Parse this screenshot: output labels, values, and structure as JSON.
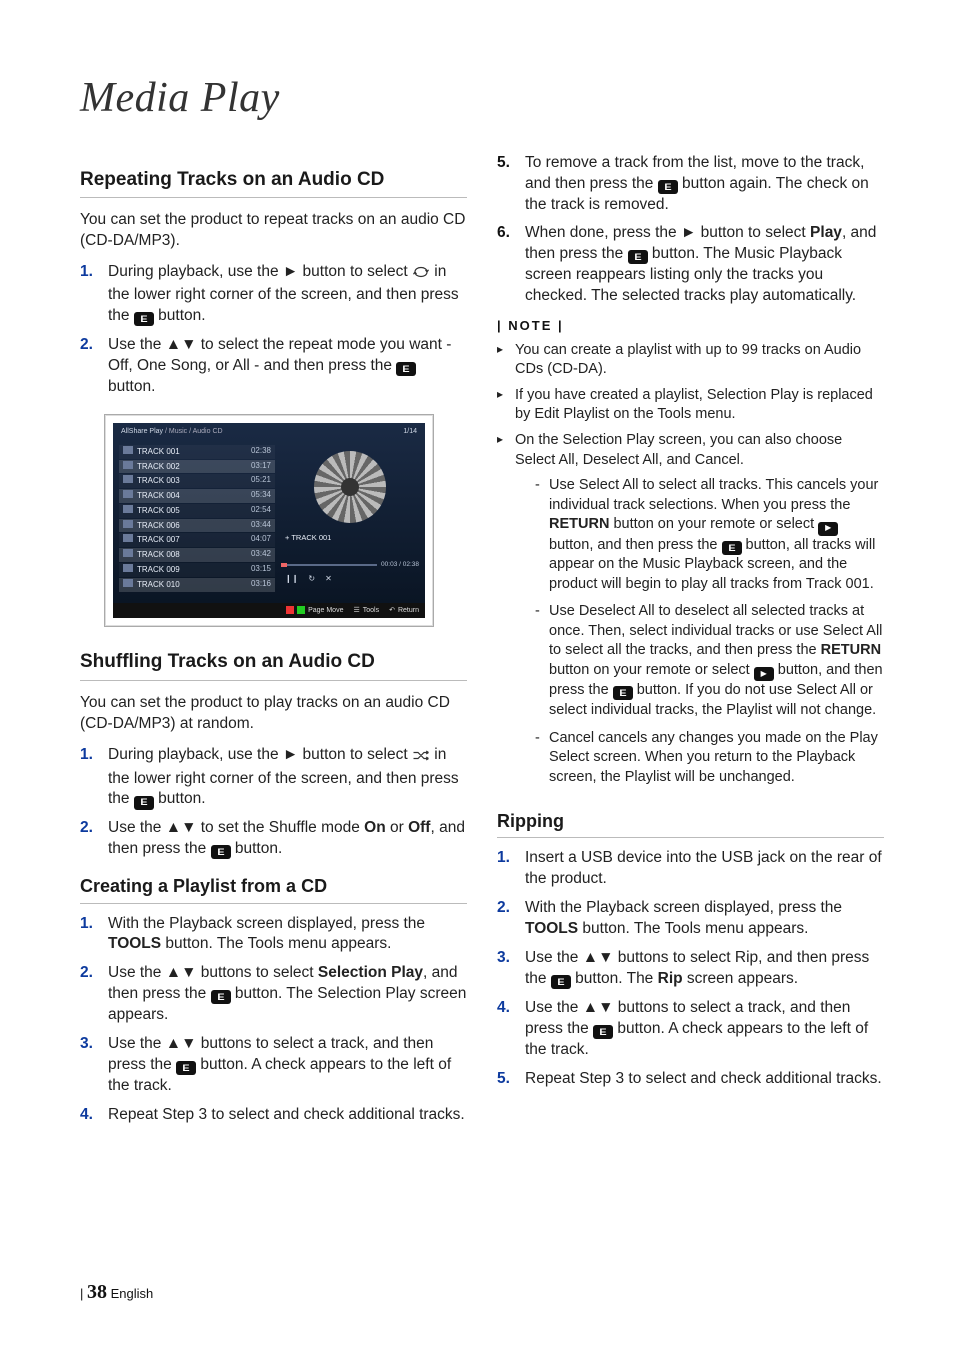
{
  "title": "Media Play",
  "footer": {
    "page": "38",
    "lang": "English",
    "bar": "|"
  },
  "sections": {
    "repeat": {
      "heading": "Repeating Tracks on an Audio CD",
      "intro": "You can set the product to repeat tracks on an audio CD (CD-DA/MP3).",
      "s1a": "During playback, use the ► button to select ",
      "s1b": " in the lower right corner of the screen, and then press the ",
      "s1c": " button.",
      "s2a": "Use the ▲▼ to select the repeat mode you want - Off, One Song, or All - and then press the ",
      "s2b": " button."
    },
    "shuffle": {
      "heading": "Shuffling Tracks on an Audio CD",
      "intro": "You can set the product to play tracks on an audio CD (CD-DA/MP3) at random.",
      "s1a": "During playback, use the ► button to select ",
      "s1b": " in the lower right corner of the screen, and then press the ",
      "s1c": " button.",
      "s2a": "Use the ▲▼ to set the Shuffle mode ",
      "s2on": "On",
      "s2or": " or ",
      "s2off": "Off",
      "s2b": ", and then press the ",
      "s2c": " button."
    },
    "playlist": {
      "heading": "Creating a Playlist from a CD",
      "s1a": "With the Playback screen displayed, press the ",
      "s1tools": "TOOLS",
      "s1b": " button. The Tools menu appears.",
      "s2a": "Use the ▲▼ buttons to select ",
      "s2sel": "Selection Play",
      "s2b": ", and then press the ",
      "s2c": " button. The Selection Play screen appears.",
      "s3a": "Use the ▲▼ buttons to select a track, and then press the ",
      "s3b": " button. A check appears to the left of the track.",
      "s4": "Repeat Step 3 to select and check additional tracks.",
      "s5a": "To remove a track from the list, move to the track, and then press the ",
      "s5b": " button again. The check on the track is removed.",
      "s6a": "When done, press the ► button to select ",
      "s6play": "Play",
      "s6b": ", and then press the ",
      "s6c": " button. The Music Playback screen reappears listing only the tracks you checked. The selected tracks play automatically."
    },
    "note": {
      "heading": "| NOTE |",
      "n1": "You can create a playlist with up to 99 tracks on Audio CDs (CD-DA).",
      "n2": "If you have created a playlist, Selection Play is replaced by Edit Playlist on the Tools menu.",
      "n3": "On the Selection Play screen, you can also choose Select All, Deselect All, and Cancel.",
      "sub1a": "Use Select All to select all tracks. This cancels your individual track selections. When you press the ",
      "sub1ret": "RETURN",
      "sub1b": " button on your remote or select ",
      "sub1c": " button, and then press the ",
      "sub1d": " button, all tracks will appear on the Music Playback screen, and the product will begin to play all tracks from Track 001.",
      "sub2a": "Use Deselect All to deselect all selected tracks at once. Then, select individual tracks or use Select All to select all the tracks, and then press the ",
      "sub2ret": "RETURN",
      "sub2b": " button on your remote or select ",
      "sub2c": " button, and then press the ",
      "sub2d": " button. If you do not use Select All or select individual tracks, the Playlist will not change.",
      "sub3": "Cancel cancels any changes you made on the Play Select screen. When you return to the Playback screen, the Playlist will be unchanged."
    },
    "ripping": {
      "heading": "Ripping",
      "s1": "Insert a USB device into the USB jack on the rear of the product.",
      "s2a": "With the Playback screen displayed, press the ",
      "s2tools": "TOOLS",
      "s2b": " button. The Tools menu appears.",
      "s3a": "Use the ▲▼ buttons to select Rip, and then press the ",
      "s3b": " button. The ",
      "s3rip": "Rip",
      "s3c": " screen appears.",
      "s4a": "Use the ▲▼ buttons to select a track, and then press the ",
      "s4b": " button. A check appears to the left of the track.",
      "s5": "Repeat Step 3 to select and check additional tracks."
    }
  },
  "mock": {
    "crumb_prefix": "AllShare Play",
    "crumb_mid": " / Music / ",
    "crumb_last": "Audio CD",
    "count": "1/14",
    "tracks": [
      {
        "t": "TRACK 001",
        "d": "02:38"
      },
      {
        "t": "TRACK 002",
        "d": "03:17"
      },
      {
        "t": "TRACK 003",
        "d": "05:21"
      },
      {
        "t": "TRACK 004",
        "d": "05:34"
      },
      {
        "t": "TRACK 005",
        "d": "02:54"
      },
      {
        "t": "TRACK 006",
        "d": "03:44"
      },
      {
        "t": "TRACK 007",
        "d": "04:07"
      },
      {
        "t": "TRACK 008",
        "d": "03:42"
      },
      {
        "t": "TRACK 009",
        "d": "03:15"
      },
      {
        "t": "TRACK 010",
        "d": "03:16"
      }
    ],
    "now": "+ TRACK 001",
    "elapsed": "00:03 / 02:38",
    "ctl_pause": "❙❙",
    "ctl_repeat": "↻",
    "ctl_shuffle": "✕",
    "btm_page": "Page Move",
    "btm_tools": "Tools",
    "btm_return": "Return"
  }
}
